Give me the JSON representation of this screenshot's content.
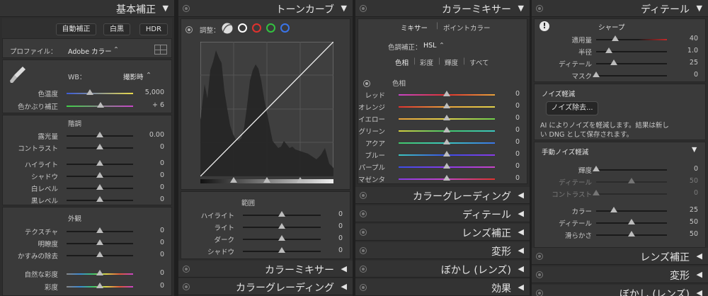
{
  "basic": {
    "title": "基本補正",
    "modes": [
      "自動補正",
      "白黒",
      "HDR"
    ],
    "profile_label": "プロファイル：",
    "profile_value": "Adobe カラー",
    "wb_label": "WB：",
    "wb_value": "撮影時",
    "color_temp_label": "色温度",
    "color_temp_value": "5,000",
    "tint_label": "色かぶり補正",
    "tint_value": "+ 6",
    "tone_group": "階調",
    "exposure_label": "露光量",
    "exposure_value": "0.00",
    "contrast_label": "コントラスト",
    "contrast_value": "0",
    "highlights_label": "ハイライト",
    "highlights_value": "0",
    "shadows_label": "シャドウ",
    "shadows_value": "0",
    "whites_label": "白レベル",
    "whites_value": "0",
    "blacks_label": "黒レベル",
    "blacks_value": "0",
    "presence_group": "外観",
    "texture_label": "テクスチャ",
    "texture_value": "0",
    "clarity_label": "明瞭度",
    "clarity_value": "0",
    "dehaze_label": "かすみの除去",
    "dehaze_value": "0",
    "vibrance_label": "自然な彩度",
    "vibrance_value": "0",
    "saturation_label": "彩度",
    "saturation_value": "0"
  },
  "tone": {
    "title": "トーンカーブ",
    "adjust_label": "調整：",
    "range_label": "範囲",
    "highlights_label": "ハイライト",
    "highlights_value": "0",
    "lights_label": "ライト",
    "lights_value": "0",
    "darks_label": "ダーク",
    "darks_value": "0",
    "shadows_label": "シャドウ",
    "shadows_value": "0",
    "collapsed": [
      "カラーミキサー",
      "カラーグレーディング"
    ]
  },
  "mixer": {
    "title": "カラーミキサー",
    "tabs": [
      "ミキサー",
      "ポイントカラー"
    ],
    "adjust_label": "色調補正：",
    "adjust_value": "HSL",
    "modes": [
      "色相",
      "彩度",
      "輝度",
      "すべて"
    ],
    "hue_group": "色相",
    "colors": [
      {
        "label": "レッド",
        "value": "0"
      },
      {
        "label": "オレンジ",
        "value": "0"
      },
      {
        "label": "イエロー",
        "value": "0"
      },
      {
        "label": "グリーン",
        "value": "0"
      },
      {
        "label": "アクア",
        "value": "0"
      },
      {
        "label": "ブルー",
        "value": "0"
      },
      {
        "label": "パープル",
        "value": "0"
      },
      {
        "label": "マゼンタ",
        "value": "0"
      }
    ],
    "collapsed": [
      "カラーグレーディング",
      "ディテール",
      "レンズ補正",
      "変形",
      "ぼかし (レンズ)",
      "効果"
    ]
  },
  "detail": {
    "title": "ディテール",
    "sharpen_group": "シャープ",
    "amount_label": "適用量",
    "amount_value": "40",
    "radius_label": "半径",
    "radius_value": "1.0",
    "detail_label": "ディテール",
    "detail_value": "25",
    "masking_label": "マスク",
    "masking_value": "0",
    "noise_title": "ノイズ軽減",
    "denoise_button": "ノイズ除去...",
    "ai_text_1": "AI によりノイズを軽減します。結果は新し",
    "ai_text_2": "い DNG として保存されます。",
    "manual_title": "手動ノイズ軽減",
    "lum_label": "輝度",
    "lum_value": "0",
    "lum_detail_label": "ディテール",
    "lum_detail_value": "50",
    "lum_contrast_label": "コントラスト",
    "lum_contrast_value": "0",
    "color_label": "カラー",
    "color_value": "25",
    "color_detail_label": "ディテール",
    "color_detail_value": "50",
    "smooth_label": "滑らかさ",
    "smooth_value": "50",
    "collapsed": [
      "レンズ補正",
      "変形",
      "ぼかし (レンズ)"
    ]
  }
}
